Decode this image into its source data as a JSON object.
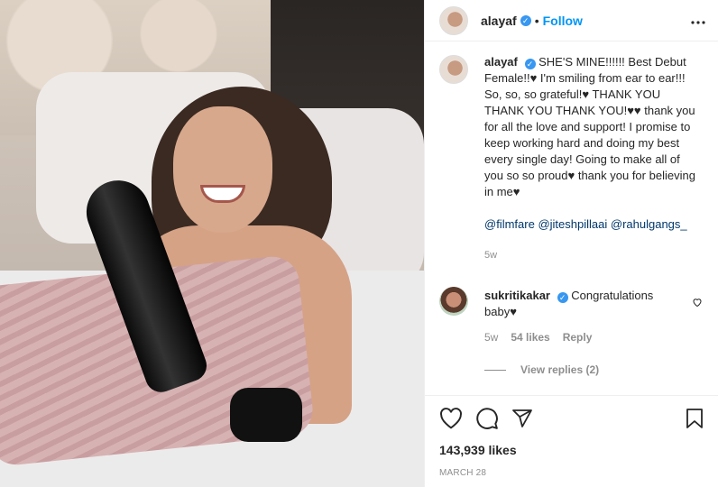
{
  "post": {
    "username": "alayaf",
    "follow_label": "Follow",
    "separator": "•",
    "more_label": "•••"
  },
  "caption": {
    "username": "alayaf",
    "text": "SHE'S MINE!!!!!! Best Debut Female!!♥ I'm smiling from ear to ear!!! So, so, so grateful!♥ THANK YOU THANK YOU THANK YOU!♥♥ thank you for all the love and support! I promise to keep working hard and doing my best every single day! Going to make all of you so so proud♥ thank you for believing in me♥",
    "mentions": [
      "@filmfare",
      "@jiteshpillaai",
      "@rahulgangs_"
    ],
    "time": "5w"
  },
  "comments": [
    {
      "username": "sukritikakar",
      "text": "Congratulations baby♥",
      "time": "5w",
      "likes": "54 likes",
      "reply_label": "Reply",
      "view_replies": "View replies (2)"
    }
  ],
  "actions": {
    "likes": "143,939 likes",
    "date": "MARCH 28"
  },
  "icons": [
    "verified-badge-icon",
    "more-options-icon",
    "heart-icon",
    "comment-icon",
    "share-icon",
    "bookmark-icon"
  ]
}
